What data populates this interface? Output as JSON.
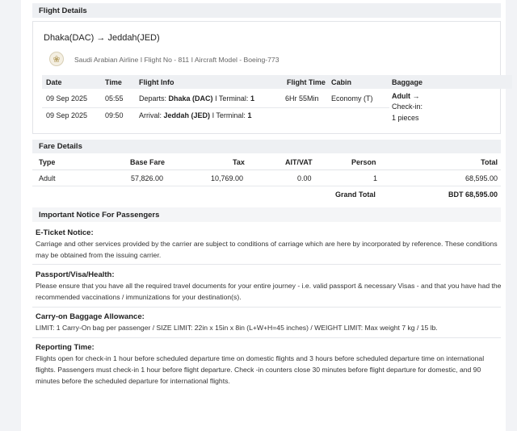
{
  "flight_details": {
    "heading": "Flight Details",
    "route": "Dhaka(DAC) → Jeddah(JED)",
    "airline_line": "Saudi Arabian Airline  I Flight No - 811  I Aircraft Model - Boeing-773",
    "columns": [
      "Date",
      "Time",
      "Flight Info",
      "Flight Time",
      "Cabin",
      "Baggage"
    ],
    "rows": [
      {
        "date": "09 Sep 2025",
        "time": "05:55",
        "info_prefix": "Departs:",
        "info_place": "Dhaka (DAC)",
        "info_terminal": "I Terminal:",
        "info_terminal_no": "1",
        "flight_time": "6Hr 55Min",
        "cabin": "Economy (T)",
        "baggage_type": "Adult →",
        "baggage_line2": "Check-in:",
        "baggage_line3": "1 pieces"
      },
      {
        "date": "09 Sep 2025",
        "time": "09:50",
        "info_prefix": "Arrival:",
        "info_place": "Jeddah (JED)",
        "info_terminal": "I Terminal:",
        "info_terminal_no": "1"
      }
    ]
  },
  "fare_details": {
    "heading": "Fare Details",
    "columns": [
      "Type",
      "Base Fare",
      "Tax",
      "AIT/VAT",
      "Person",
      "Total"
    ],
    "row": {
      "type": "Adult",
      "base_fare": "57,826.00",
      "tax": "10,769.00",
      "ait_vat": "0.00",
      "person": "1",
      "total": "68,595.00"
    },
    "grand_total_label": "Grand Total",
    "grand_total_value": "BDT 68,595.00"
  },
  "notice": {
    "heading": "Important Notice For Passengers",
    "items": [
      {
        "title": "E-Ticket Notice:",
        "text": "Carriage and other services provided by the carrier are subject to conditions of carriage which are here by incorporated by reference. These conditions may be obtained from the issuing carrier."
      },
      {
        "title": "Passport/Visa/Health:",
        "text": "Please ensure that you have all the required travel documents for your entire journey - i.e. valid passport & necessary Visas - and that you have had the recommended vaccinations / immunizations for your destination(s)."
      },
      {
        "title": "Carry-on Baggage Allowance:",
        "text": "LIMIT: 1 Carry-On bag per passenger / SIZE LIMIT: 22in x 15in x 8in (L+W+H=45 inches) / WEIGHT LIMIT: Max weight 7 kg / 15 lb."
      },
      {
        "title": "Reporting Time:",
        "text": "Flights open for check-in 1 hour before scheduled departure time on domestic flights and 3 hours before scheduled departure time on international flights. Passengers must check-in 1 hour before flight departure. Check -in counters close 30 minutes before flight departure for domestic, and 90 minutes before the scheduled departure for international flights."
      }
    ]
  }
}
